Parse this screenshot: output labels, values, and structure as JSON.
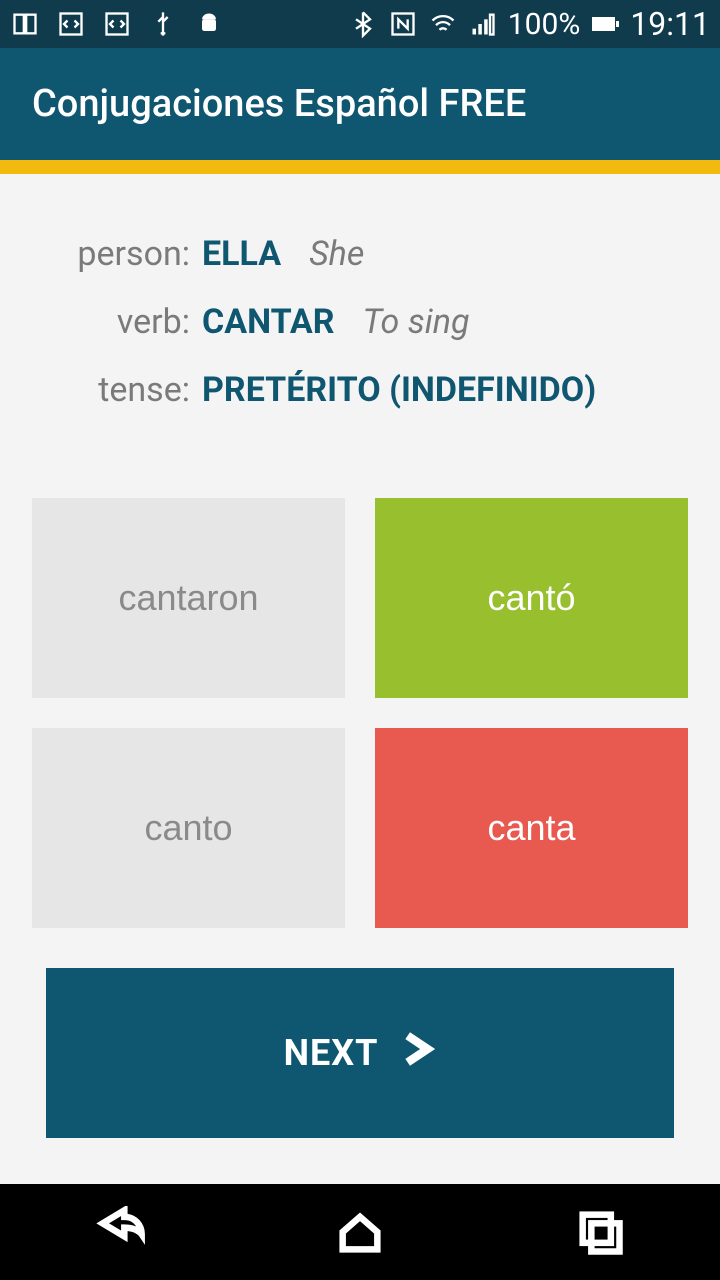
{
  "status": {
    "battery_pct": "100%",
    "time": "19:11"
  },
  "app": {
    "title": "Conjugaciones Español FREE"
  },
  "quiz": {
    "labels": {
      "person": "person:",
      "verb": "verb:",
      "tense": "tense:"
    },
    "person": {
      "value": "ELLA",
      "translation": "She"
    },
    "verb": {
      "value": "CANTAR",
      "translation": "To sing"
    },
    "tense": {
      "value": "PRETÉRITO (INDEFINIDO)"
    },
    "options": [
      {
        "text": "cantaron",
        "state": "inactive"
      },
      {
        "text": "cantó",
        "state": "correct"
      },
      {
        "text": "canto",
        "state": "inactive"
      },
      {
        "text": "canta",
        "state": "wrong"
      }
    ],
    "next_label": "NEXT"
  }
}
